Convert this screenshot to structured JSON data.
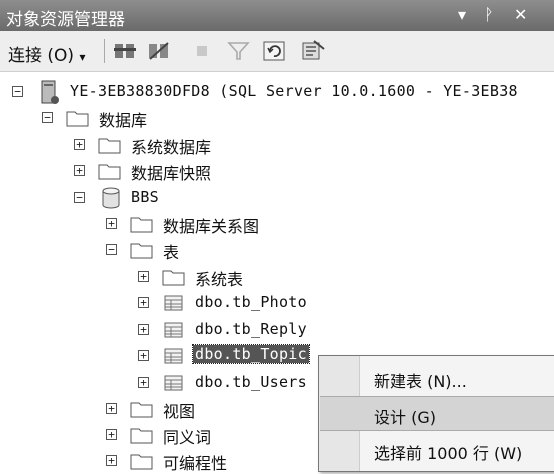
{
  "window": {
    "title": "对象资源管理器",
    "controls": [
      "▾",
      "ᚹ",
      "✕"
    ]
  },
  "toolbar": {
    "connect_label": "连接 (O)",
    "connect_arrow": "▾"
  },
  "tree": {
    "server": "YE-3EB38830DFD8 (SQL Server 10.0.1600 - YE-3EB38",
    "databases": "数据库",
    "system_databases": "系统数据库",
    "db_snapshots": "数据库快照",
    "bbs": "BBS",
    "db_diagrams": "数据库关系图",
    "tables": "表",
    "system_tables": "系统表",
    "t_photo": "dbo.tb_Photo",
    "t_reply": "dbo.tb_Reply",
    "t_topic": "dbo.tb_Topic",
    "t_users": "dbo.tb_Users",
    "views": "视图",
    "synonyms": "同义词",
    "programmability": "可编程性"
  },
  "context_menu": {
    "new_table": "新建表 (N)...",
    "design": "设计 (G)",
    "select_top": "选择前 1000 行 (W)"
  },
  "icons": {
    "expanded": "−",
    "collapsed": "+"
  }
}
